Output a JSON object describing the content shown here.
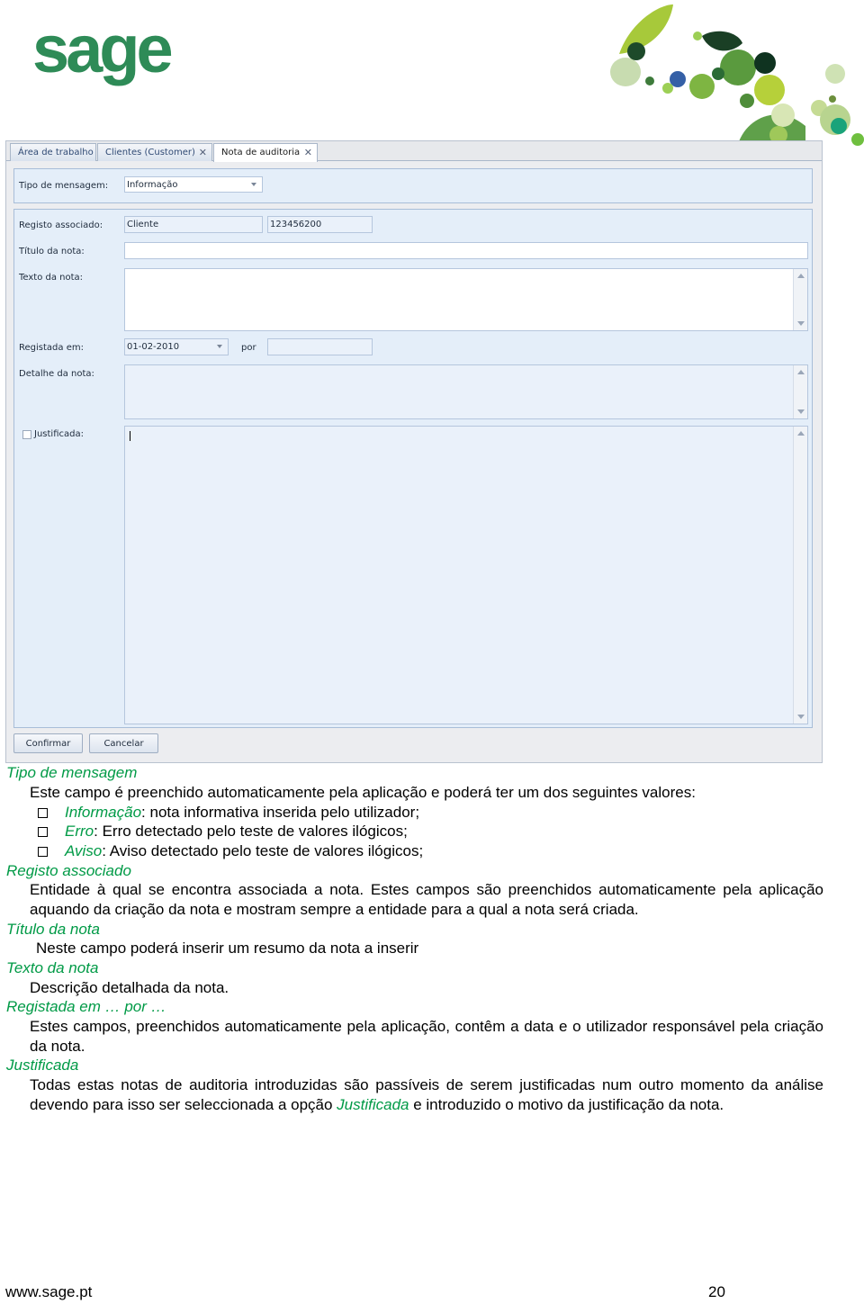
{
  "brand": {
    "logo_text": "sage",
    "logo_color": "#2e8b57"
  },
  "window": {
    "tabs": [
      {
        "label": "Área de trabalho"
      },
      {
        "label": "Clientes (Customer)"
      },
      {
        "label": "Nota de auditoria"
      }
    ],
    "active_tab": "Nota de auditoria",
    "form": {
      "tipo_mensagem_label": "Tipo de mensagem:",
      "tipo_mensagem_value": "Informação",
      "registo_label": "Registo associado:",
      "registo_tipo": "Cliente",
      "registo_codigo": "123456200",
      "titulo_label": "Título da nota:",
      "titulo_value": "",
      "texto_label": "Texto da nota:",
      "texto_value": "",
      "registada_label": "Registada em:",
      "registada_data": "01-02-2010",
      "por_label": "por",
      "por_value": "",
      "detalhe_label": "Detalhe da nota:",
      "justificada_label": "Justificada:",
      "justificada_checked": false
    },
    "buttons": {
      "confirm": "Confirmar",
      "cancel": "Cancelar"
    }
  },
  "doc": {
    "h1": "Tipo de mensagem",
    "p1": "Este campo é preenchido automaticamente pela aplicação e poderá ter um dos seguintes valores:",
    "bullets": [
      {
        "term": "Informação",
        "text": ": nota informativa inserida pelo utilizador;"
      },
      {
        "term": "Erro",
        "text": ": Erro detectado pelo teste de valores ilógicos;"
      },
      {
        "term": "Aviso",
        "text": ": Aviso detectado pelo teste de valores ilógicos;"
      }
    ],
    "h2": "Registo associado",
    "p2": "Entidade à qual se encontra associada a nota. Estes campos são preenchidos automaticamente pela aplicação aquando da criação da nota e mostram sempre a entidade para a qual a nota será criada.",
    "h3": "Título da nota",
    "p3": "Neste campo poderá inserir um resumo da nota a inserir",
    "h4": "Texto da nota",
    "p4": "Descrição detalhada da nota.",
    "h5": "Registada em … por …",
    "p5": "Estes campos, preenchidos automaticamente pela aplicação, contêm a data e o utilizador responsável pela criação da nota.",
    "h6": "Justificada",
    "p6_before": "Todas estas notas de auditoria introduzidas são passíveis de serem justificadas num outro momento da análise devendo para isso ser seleccionada a opção ",
    "p6_term": "Justificada",
    "p6_after": " e introduzido o motivo da justificação da nota."
  },
  "footer": {
    "url": "www.sage.pt",
    "page": "20"
  },
  "colors": {
    "accent_green": "#009a46",
    "panel_blue": "#e4eef9"
  }
}
